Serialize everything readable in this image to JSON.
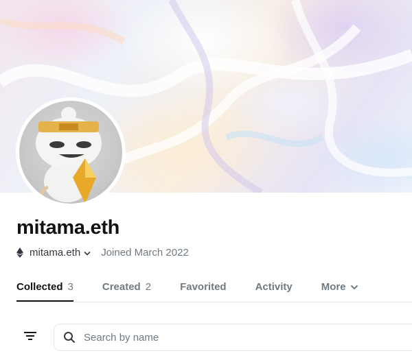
{
  "profile": {
    "name": "mitama.eth",
    "wallet_label": "mitama.eth",
    "joined": "Joined March 2022"
  },
  "tabs": [
    {
      "label": "Collected",
      "count": "3",
      "active": true
    },
    {
      "label": "Created",
      "count": "2",
      "active": false
    },
    {
      "label": "Favorited",
      "count": "",
      "active": false
    },
    {
      "label": "Activity",
      "count": "",
      "active": false
    },
    {
      "label": "More",
      "count": "",
      "active": false
    }
  ],
  "search": {
    "placeholder": "Search by name"
  },
  "icons": {
    "wallet": "ethereum-icon",
    "wallet_menu": "chevron-down-icon",
    "more_menu": "chevron-down-icon",
    "filter": "filter-icon",
    "search": "search-icon"
  },
  "colors": {
    "text_primary": "#121212",
    "text_secondary": "#707a83",
    "border": "#e5e8eb"
  }
}
